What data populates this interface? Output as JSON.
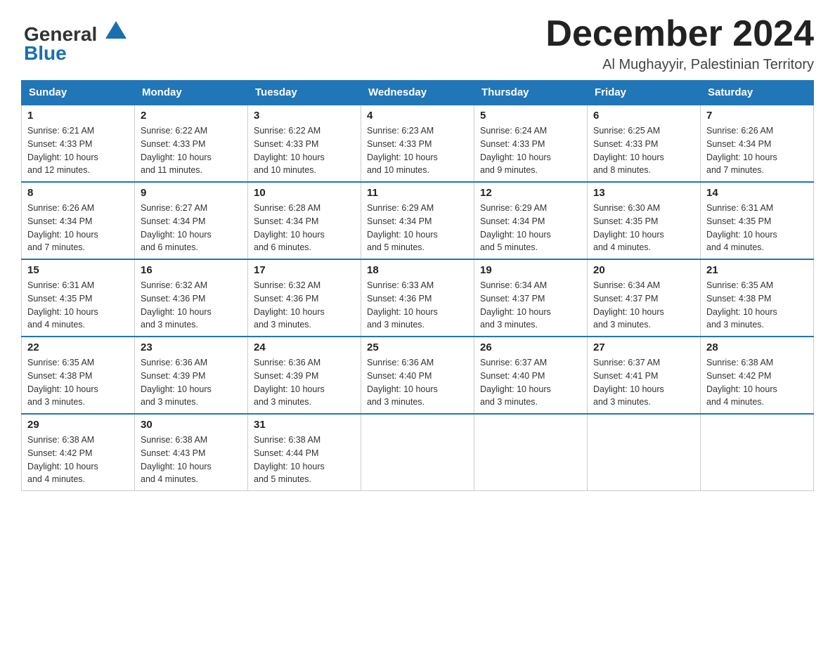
{
  "header": {
    "logo_line1": "General",
    "logo_line2": "Blue",
    "month_title": "December 2024",
    "location": "Al Mughayyir, Palestinian Territory"
  },
  "days_of_week": [
    "Sunday",
    "Monday",
    "Tuesday",
    "Wednesday",
    "Thursday",
    "Friday",
    "Saturday"
  ],
  "weeks": [
    [
      {
        "day": "1",
        "sunrise": "6:21 AM",
        "sunset": "4:33 PM",
        "daylight": "10 hours and 12 minutes."
      },
      {
        "day": "2",
        "sunrise": "6:22 AM",
        "sunset": "4:33 PM",
        "daylight": "10 hours and 11 minutes."
      },
      {
        "day": "3",
        "sunrise": "6:22 AM",
        "sunset": "4:33 PM",
        "daylight": "10 hours and 10 minutes."
      },
      {
        "day": "4",
        "sunrise": "6:23 AM",
        "sunset": "4:33 PM",
        "daylight": "10 hours and 10 minutes."
      },
      {
        "day": "5",
        "sunrise": "6:24 AM",
        "sunset": "4:33 PM",
        "daylight": "10 hours and 9 minutes."
      },
      {
        "day": "6",
        "sunrise": "6:25 AM",
        "sunset": "4:33 PM",
        "daylight": "10 hours and 8 minutes."
      },
      {
        "day": "7",
        "sunrise": "6:26 AM",
        "sunset": "4:34 PM",
        "daylight": "10 hours and 7 minutes."
      }
    ],
    [
      {
        "day": "8",
        "sunrise": "6:26 AM",
        "sunset": "4:34 PM",
        "daylight": "10 hours and 7 minutes."
      },
      {
        "day": "9",
        "sunrise": "6:27 AM",
        "sunset": "4:34 PM",
        "daylight": "10 hours and 6 minutes."
      },
      {
        "day": "10",
        "sunrise": "6:28 AM",
        "sunset": "4:34 PM",
        "daylight": "10 hours and 6 minutes."
      },
      {
        "day": "11",
        "sunrise": "6:29 AM",
        "sunset": "4:34 PM",
        "daylight": "10 hours and 5 minutes."
      },
      {
        "day": "12",
        "sunrise": "6:29 AM",
        "sunset": "4:34 PM",
        "daylight": "10 hours and 5 minutes."
      },
      {
        "day": "13",
        "sunrise": "6:30 AM",
        "sunset": "4:35 PM",
        "daylight": "10 hours and 4 minutes."
      },
      {
        "day": "14",
        "sunrise": "6:31 AM",
        "sunset": "4:35 PM",
        "daylight": "10 hours and 4 minutes."
      }
    ],
    [
      {
        "day": "15",
        "sunrise": "6:31 AM",
        "sunset": "4:35 PM",
        "daylight": "10 hours and 4 minutes."
      },
      {
        "day": "16",
        "sunrise": "6:32 AM",
        "sunset": "4:36 PM",
        "daylight": "10 hours and 3 minutes."
      },
      {
        "day": "17",
        "sunrise": "6:32 AM",
        "sunset": "4:36 PM",
        "daylight": "10 hours and 3 minutes."
      },
      {
        "day": "18",
        "sunrise": "6:33 AM",
        "sunset": "4:36 PM",
        "daylight": "10 hours and 3 minutes."
      },
      {
        "day": "19",
        "sunrise": "6:34 AM",
        "sunset": "4:37 PM",
        "daylight": "10 hours and 3 minutes."
      },
      {
        "day": "20",
        "sunrise": "6:34 AM",
        "sunset": "4:37 PM",
        "daylight": "10 hours and 3 minutes."
      },
      {
        "day": "21",
        "sunrise": "6:35 AM",
        "sunset": "4:38 PM",
        "daylight": "10 hours and 3 minutes."
      }
    ],
    [
      {
        "day": "22",
        "sunrise": "6:35 AM",
        "sunset": "4:38 PM",
        "daylight": "10 hours and 3 minutes."
      },
      {
        "day": "23",
        "sunrise": "6:36 AM",
        "sunset": "4:39 PM",
        "daylight": "10 hours and 3 minutes."
      },
      {
        "day": "24",
        "sunrise": "6:36 AM",
        "sunset": "4:39 PM",
        "daylight": "10 hours and 3 minutes."
      },
      {
        "day": "25",
        "sunrise": "6:36 AM",
        "sunset": "4:40 PM",
        "daylight": "10 hours and 3 minutes."
      },
      {
        "day": "26",
        "sunrise": "6:37 AM",
        "sunset": "4:40 PM",
        "daylight": "10 hours and 3 minutes."
      },
      {
        "day": "27",
        "sunrise": "6:37 AM",
        "sunset": "4:41 PM",
        "daylight": "10 hours and 3 minutes."
      },
      {
        "day": "28",
        "sunrise": "6:38 AM",
        "sunset": "4:42 PM",
        "daylight": "10 hours and 4 minutes."
      }
    ],
    [
      {
        "day": "29",
        "sunrise": "6:38 AM",
        "sunset": "4:42 PM",
        "daylight": "10 hours and 4 minutes."
      },
      {
        "day": "30",
        "sunrise": "6:38 AM",
        "sunset": "4:43 PM",
        "daylight": "10 hours and 4 minutes."
      },
      {
        "day": "31",
        "sunrise": "6:38 AM",
        "sunset": "4:44 PM",
        "daylight": "10 hours and 5 minutes."
      },
      null,
      null,
      null,
      null
    ]
  ]
}
